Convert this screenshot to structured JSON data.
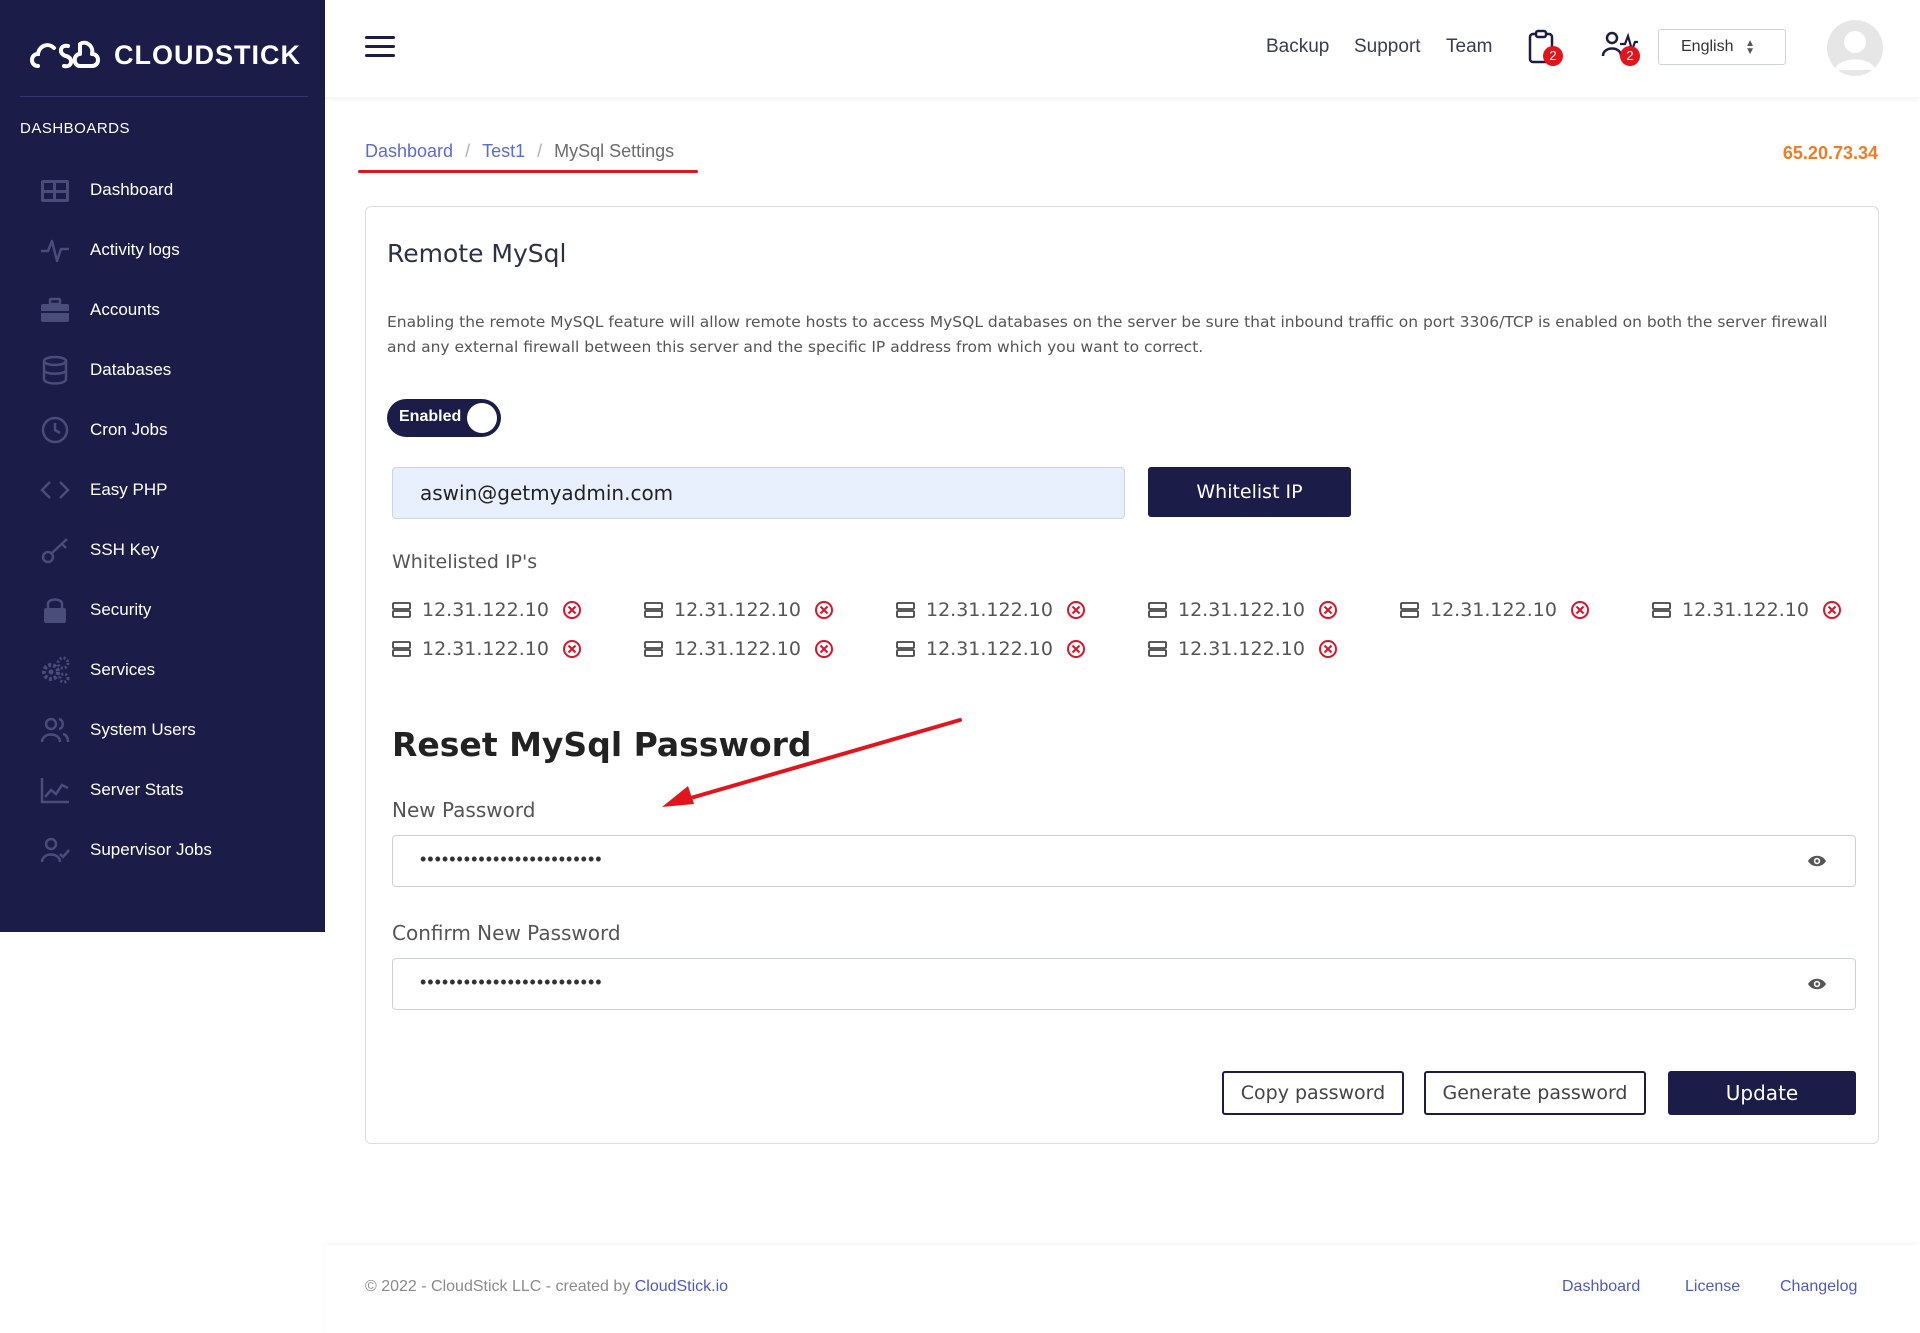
{
  "brand": {
    "name": "CLOUDSTICK"
  },
  "sidebar": {
    "section_title": "DASHBOARDS",
    "items": [
      {
        "label": "Dashboard",
        "icon": "dashboard-icon"
      },
      {
        "label": "Activity logs",
        "icon": "activity-icon"
      },
      {
        "label": "Accounts",
        "icon": "briefcase-icon"
      },
      {
        "label": "Databases",
        "icon": "database-icon"
      },
      {
        "label": "Cron Jobs",
        "icon": "clock-icon"
      },
      {
        "label": "Easy PHP",
        "icon": "code-icon"
      },
      {
        "label": "SSH Key",
        "icon": "key-icon"
      },
      {
        "label": "Security",
        "icon": "lock-icon"
      },
      {
        "label": "Services",
        "icon": "gears-icon"
      },
      {
        "label": "System Users",
        "icon": "users-icon"
      },
      {
        "label": "Server Stats",
        "icon": "chart-icon"
      },
      {
        "label": "Supervisor Jobs",
        "icon": "user-check-icon"
      }
    ]
  },
  "topbar": {
    "links": [
      "Backup",
      "Support",
      "Team"
    ],
    "clipboard_badge": "2",
    "team_badge": "2",
    "language": "English"
  },
  "breadcrumb": {
    "items": [
      "Dashboard",
      "Test1"
    ],
    "current": "MySql Settings"
  },
  "server_ip": "65.20.73.34",
  "remote_mysql": {
    "title": "Remote MySql",
    "description": "Enabling the remote MySQL feature will allow remote hosts to access MySQL databases on the server be sure that inbound traffic on port 3306/TCP is enabled on both the server firewall and any external firewall between this server and the specific IP address from which you want to correct.",
    "toggle_label": "Enabled",
    "input_value": "aswin@getmyadmin.com",
    "whitelist_button": "Whitelist IP",
    "whitelisted_label": "Whitelisted IP's",
    "ips": [
      "12.31.122.10",
      "12.31.122.10",
      "12.31.122.10",
      "12.31.122.10",
      "12.31.122.10",
      "12.31.122.10",
      "12.31.122.10",
      "12.31.122.10",
      "12.31.122.10",
      "12.31.122.10"
    ]
  },
  "reset_password": {
    "title": "Reset MySql Password",
    "new_label": "New Password",
    "new_value": "•••••••••••••••••••••••••",
    "confirm_label": "Confirm New Password",
    "confirm_value": "•••••••••••••••••••••••••",
    "copy_button": "Copy password",
    "generate_button": "Generate password",
    "update_button": "Update"
  },
  "footer": {
    "copyright_prefix": "© 2022 - CloudStick LLC - created by",
    "copyright_link": "CloudStick.io",
    "links": [
      "Dashboard",
      "License",
      "Changelog"
    ]
  },
  "colors": {
    "sidebar_bg": "#1b1c47",
    "accent": "#1b1c47",
    "link": "#5b6bd5",
    "ip_orange": "#f07b23",
    "badge_red": "#e3151c",
    "remove_red": "#d9142b"
  }
}
